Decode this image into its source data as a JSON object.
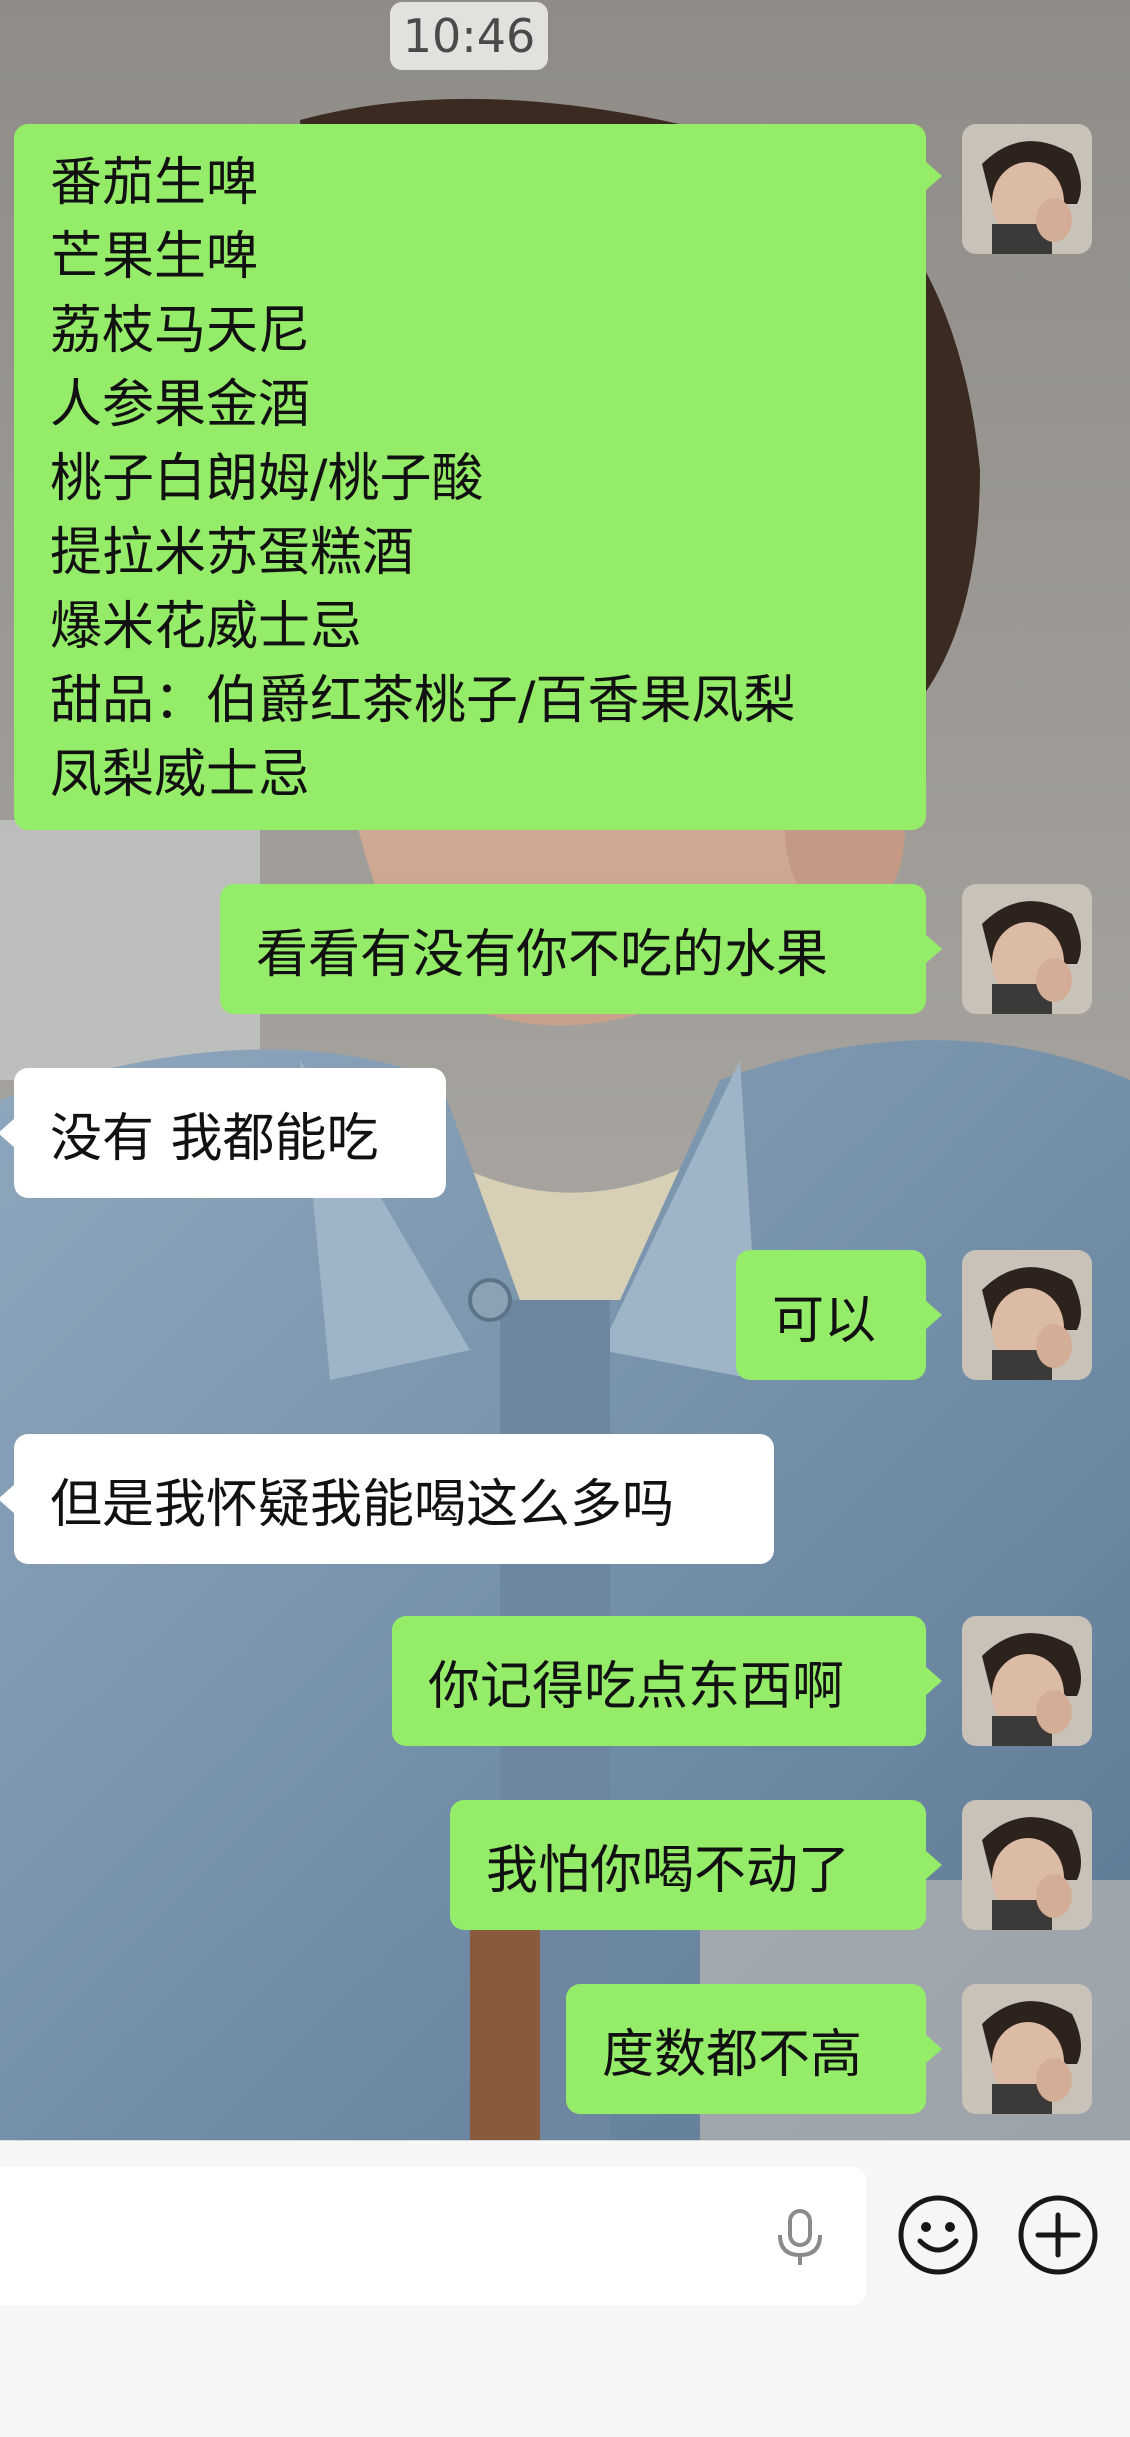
{
  "timestamp": "10:46",
  "menu_lines": [
    "番茄生啤",
    "芒果生啤",
    "荔枝马天尼",
    "人参果金酒",
    "桃子白朗姆/桃子酸",
    "提拉米苏蛋糕酒",
    "爆米花威士忌",
    "甜品：伯爵红茶桃子/百香果凤梨",
    "凤梨威士忌"
  ],
  "messages": [
    {
      "side": "sent",
      "text": "看看有没有你不吃的水果"
    },
    {
      "side": "received",
      "text": "没有 我都能吃"
    },
    {
      "side": "sent",
      "text": "可以"
    },
    {
      "side": "received",
      "text": "但是我怀疑我能喝这么多吗"
    },
    {
      "side": "sent",
      "text": "你记得吃点东西啊"
    },
    {
      "side": "sent",
      "text": "我怕你喝不动了"
    },
    {
      "side": "sent",
      "text": "度数都不高"
    }
  ],
  "colors": {
    "sent_bubble": "#95ec69",
    "received_bubble": "#ffffff",
    "input_bar": "#f6f6f6"
  },
  "icons": {
    "mic": "mic-icon",
    "emoji": "smiley-icon",
    "plus": "plus-circle-icon"
  }
}
